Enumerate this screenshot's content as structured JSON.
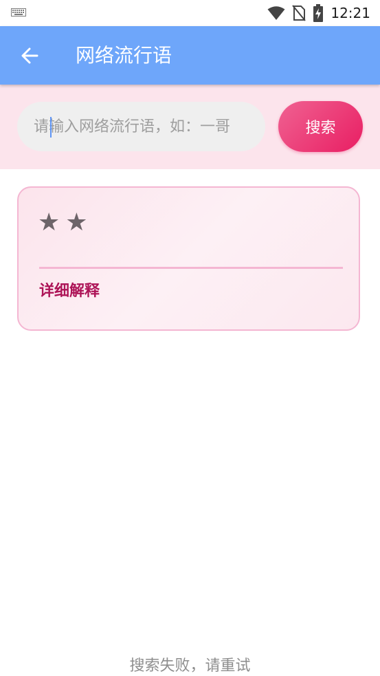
{
  "status_bar": {
    "time": "12:21",
    "icons": [
      "keyboard-icon",
      "wifi-icon",
      "no-sim-icon",
      "battery-charging-icon"
    ]
  },
  "app_bar": {
    "back_icon": "arrow-back-icon",
    "title": "网络流行语"
  },
  "search": {
    "value": "",
    "placeholder": "请输入网络流行语，如：一哥",
    "button_label": "搜索"
  },
  "result": {
    "word": "★★",
    "detail_label": "详细解释",
    "explanation": ""
  },
  "status_message": "搜索失败，请重试",
  "colors": {
    "app_bar": "#6ea6fa",
    "search_area_bg": "#fce4ec",
    "button_gradient": [
      "#f06292",
      "#e91e63"
    ],
    "card_border": "#f4b6d2",
    "detail_label": "#ad1457"
  }
}
